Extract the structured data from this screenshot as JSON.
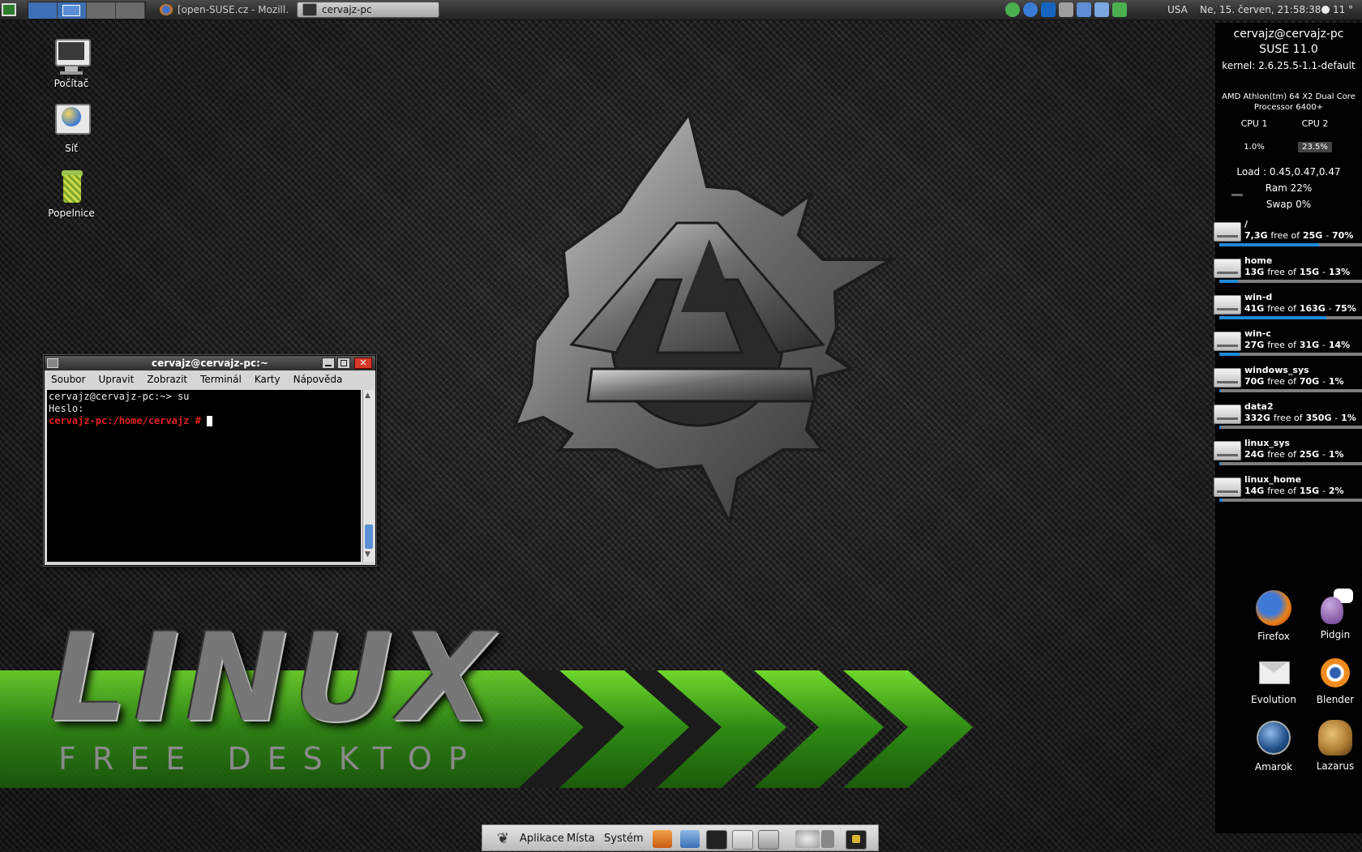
{
  "top_panel": {
    "tasks": [
      {
        "label": "[open-SUSE.cz - Mozill..."
      },
      {
        "label": "cervajz-pc"
      }
    ],
    "keyboard_layout": "USA",
    "datetime": "Ne, 15. červen, 21:58:38",
    "weather": "11 °"
  },
  "desktop_icons": [
    {
      "label": "Počítač"
    },
    {
      "label": "Síť"
    },
    {
      "label": "Popelnice"
    }
  ],
  "right_icons": [
    {
      "label": "Firefox"
    },
    {
      "label": "Pidgin"
    },
    {
      "label": "Evolution"
    },
    {
      "label": "Blender"
    },
    {
      "label": "Amarok"
    },
    {
      "label": "Lazarus"
    }
  ],
  "conky": {
    "user_host": "cervajz@cervajz-pc",
    "distro": "SUSE 11.0",
    "kernel": "kernel: 2.6.25.5-1.1-default",
    "cpu_model_1": "AMD Athlon(tm) 64 X2 Dual Core",
    "cpu_model_2": "Processor 6400+",
    "cpu1_label": "CPU 1",
    "cpu2_label": "CPU 2",
    "cpu1_value": "1.0%",
    "cpu2_value": "23.5%",
    "load": "Load : 0.45,0.47,0.47",
    "ram": "Ram 22%",
    "swap": "Swap 0%",
    "disks": [
      {
        "name": "/",
        "free": "7,3G",
        "total": "25G",
        "pct": "70%",
        "used": 0.7
      },
      {
        "name": "home",
        "free": "13G",
        "total": "15G",
        "pct": "13%",
        "used": 0.13
      },
      {
        "name": "win-d",
        "free": "41G",
        "total": "163G",
        "pct": "75%",
        "used": 0.75
      },
      {
        "name": "win-c",
        "free": "27G",
        "total": "31G",
        "pct": "14%",
        "used": 0.14
      },
      {
        "name": "windows_sys",
        "free": "70G",
        "total": "70G",
        "pct": "1%",
        "used": 0.01
      },
      {
        "name": "data2",
        "free": "332G",
        "total": "350G",
        "pct": "1%",
        "used": 0.01
      },
      {
        "name": "linux_sys",
        "free": "24G",
        "total": "25G",
        "pct": "1%",
        "used": 0.01
      },
      {
        "name": "linux_home",
        "free": "14G",
        "total": "15G",
        "pct": "2%",
        "used": 0.02
      }
    ],
    "free_of": "free of",
    "dash": "-"
  },
  "terminal": {
    "title": "cervajz@cervajz-pc:~",
    "menu": [
      "Soubor",
      "Upravit",
      "Zobrazit",
      "Terminál",
      "Karty",
      "Nápověda"
    ],
    "lines": [
      "cervajz@cervajz-pc:~> su",
      "Heslo:"
    ],
    "root_prompt": "cervajz-pc:/home/cervajz #"
  },
  "branding": {
    "word": "LINUX",
    "tagline": "FREE DESKTOP"
  },
  "bottom_panel": {
    "menus": [
      "Aplikace",
      "Místa",
      "Systém"
    ]
  },
  "colors": {
    "accent_blue": "#1e8ad8",
    "prompt_red": "#e02020",
    "green_arrows": "#3e9a1c"
  }
}
